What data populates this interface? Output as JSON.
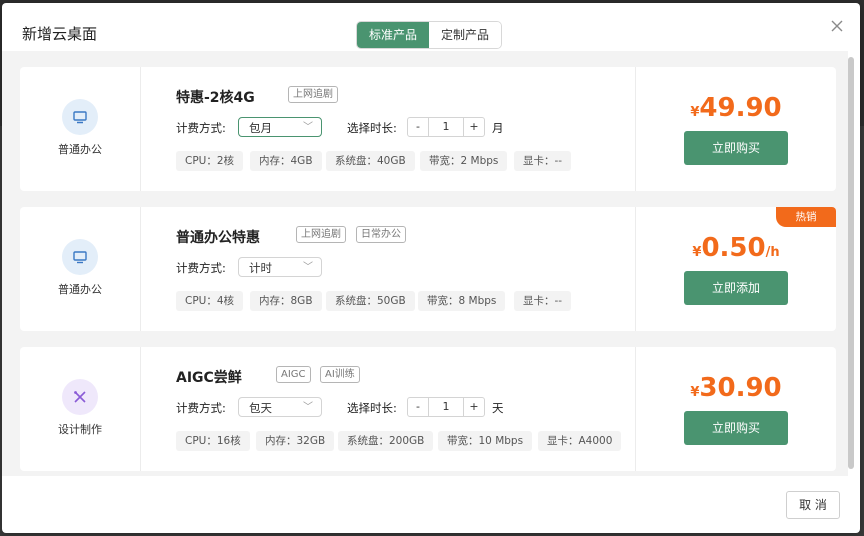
{
  "dialog": {
    "title": "新增云桌面",
    "tabs": [
      "标准产品",
      "定制产品"
    ],
    "active_tab": "标准产品",
    "cancel_label": "取 消"
  },
  "products": [
    {
      "category": "普通办公",
      "category_icon": "monitor-icon",
      "name": "特惠-2核4G",
      "tags": [
        "上网追剧"
      ],
      "billing_label": "计费方式:",
      "billing_value": "包月",
      "duration_label": "选择时长:",
      "duration_minus": "-",
      "duration_value": "1",
      "duration_plus": "+",
      "duration_unit": "月",
      "specs": [
        "CPU：2核",
        "内存：4GB",
        "系统盘：40GB",
        "带宽：2 Mbps",
        "显卡：--"
      ],
      "price_currency": "¥",
      "price": "49.90",
      "price_unit": "",
      "action_label": "立即购买",
      "badge": ""
    },
    {
      "category": "普通办公",
      "category_icon": "monitor-icon",
      "name": "普通办公特惠",
      "tags": [
        "上网追剧",
        "日常办公"
      ],
      "billing_label": "计费方式:",
      "billing_value": "计时",
      "specs": [
        "CPU：4核",
        "内存：8GB",
        "系统盘：50GB",
        "带宽：8 Mbps",
        "显卡：--"
      ],
      "price_currency": "¥",
      "price": "0.50",
      "price_unit": "/h",
      "action_label": "立即添加",
      "badge": "热销"
    },
    {
      "category": "设计制作",
      "category_icon": "design-tools-icon",
      "name": "AIGC尝鲜",
      "tags": [
        "AIGC",
        "AI训练"
      ],
      "billing_label": "计费方式:",
      "billing_value": "包天",
      "duration_label": "选择时长:",
      "duration_minus": "-",
      "duration_value": "1",
      "duration_plus": "+",
      "duration_unit": "天",
      "specs": [
        "CPU：16核",
        "内存：32GB",
        "系统盘：200GB",
        "带宽：10 Mbps",
        "显卡：A4000"
      ],
      "price_currency": "¥",
      "price": "30.90",
      "price_unit": "",
      "action_label": "立即购买",
      "badge": ""
    }
  ],
  "colors": {
    "accent": "#4a9470",
    "price": "#f26a1b"
  }
}
